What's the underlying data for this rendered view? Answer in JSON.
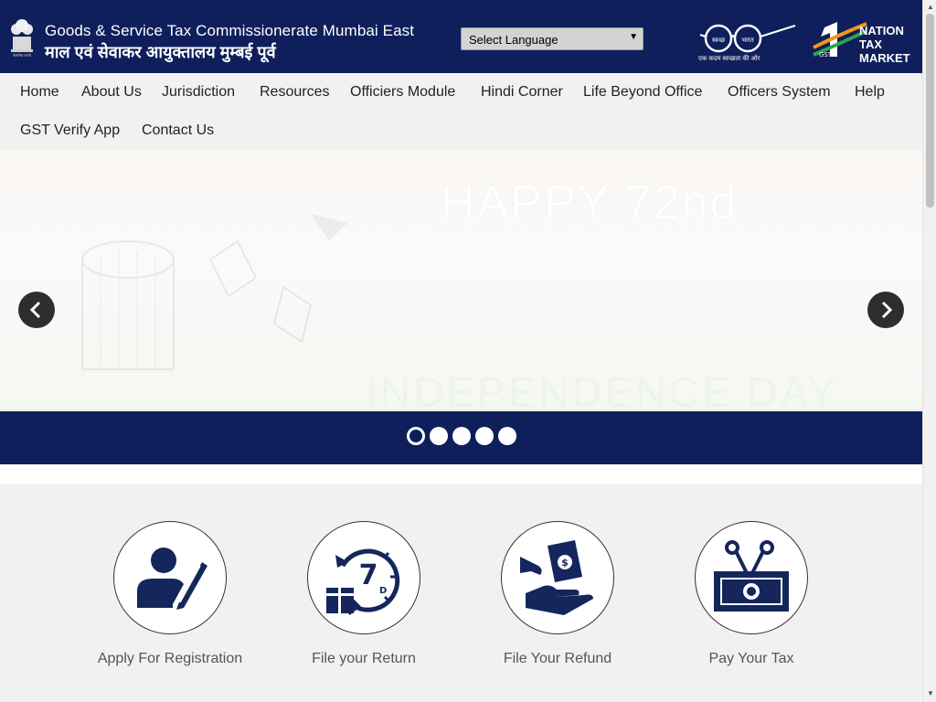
{
  "header": {
    "title_en": "Goods & Service Tax Commissionerate Mumbai East",
    "title_hi": "माल एवं सेवाकर आयुक्तालय मुम्बई पूर्व",
    "language_select": "Select Language",
    "swachh_caption": "एक कदम स्वच्छता की ओर",
    "swachh_left": "स्वच्छ",
    "swachh_right": "भारत",
    "one_nation": [
      "NATION",
      "TAX",
      "MARKET"
    ],
    "gst_mark": "GST"
  },
  "nav": {
    "items": [
      {
        "label": "Home"
      },
      {
        "label": "About Us"
      },
      {
        "label": "Jurisdiction"
      },
      {
        "label": "Resources"
      },
      {
        "label": "Officiers Module"
      },
      {
        "label": "Hindi Corner"
      },
      {
        "label": "Life Beyond Office"
      },
      {
        "label": "Officers System"
      },
      {
        "label": "Help"
      },
      {
        "label": "GST Verify App"
      },
      {
        "label": "Contact Us"
      }
    ]
  },
  "slider": {
    "headline": "HAPPY 72nd",
    "bottom_text": "INDEPENDENCE DAY",
    "prev_icon": "chevron-left-icon",
    "next_icon": "chevron-right-icon",
    "dot_count": 5,
    "active_dot": 0
  },
  "services": [
    {
      "label": "Apply For Registration",
      "icon": "user-edit-icon"
    },
    {
      "label": "File your Return",
      "icon": "calendar-return-icon"
    },
    {
      "label": "File Your Refund",
      "icon": "refund-hand-icon"
    },
    {
      "label": "Pay Your Tax",
      "icon": "cut-banknote-icon"
    }
  ],
  "colors": {
    "brand_navy": "#0e1f5b",
    "nav_bg": "#f1f1f1",
    "icon_navy": "#14265c"
  }
}
